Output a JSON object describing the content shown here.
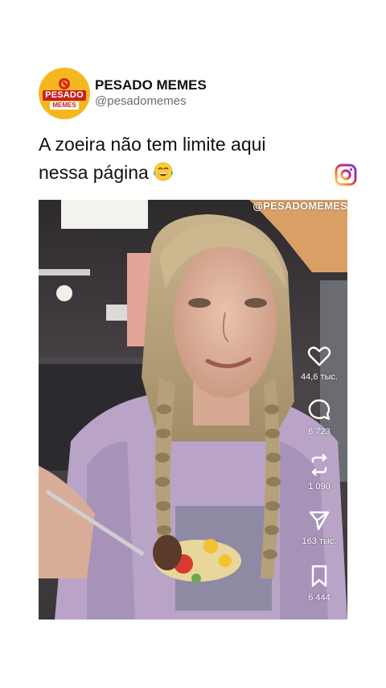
{
  "post": {
    "account_name": "PESADO MEMES",
    "handle": "@pesadomemes",
    "avatar_logo": {
      "top": "PESADO",
      "bottom": "MEMES"
    },
    "caption_line1": "A zoeira não tem limite aqui",
    "caption_line2": "nessa página",
    "caption_emoji": "face-with-tears-of-joy-icon",
    "platform_icon": "instagram-icon"
  },
  "video": {
    "watermark": "@PESADOMEMES",
    "actions": [
      {
        "icon": "heart-icon",
        "count": "44,6 тыс."
      },
      {
        "icon": "comment-icon",
        "count": "6 723"
      },
      {
        "icon": "repost-icon",
        "count": "1 090"
      },
      {
        "icon": "share-icon",
        "count": "163 тыс."
      },
      {
        "icon": "bookmark-icon",
        "count": "6 444"
      }
    ]
  },
  "colors": {
    "avatar_bg": "#f4b81f",
    "brand_red": "#c8201b",
    "instagram_gradient": [
      "#feda75",
      "#fa7e1e",
      "#d62976",
      "#962fbf",
      "#4f5bd5"
    ]
  }
}
